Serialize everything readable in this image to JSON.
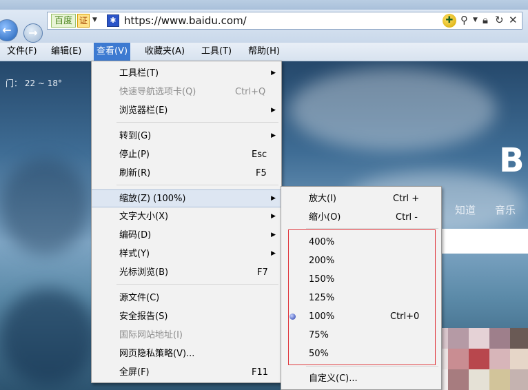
{
  "address_bar": {
    "search_engine_label": "百度",
    "cert_label": "证",
    "url": "https://www.baidu.com/"
  },
  "menubar": [
    {
      "label": "文件(F)"
    },
    {
      "label": "编辑(E)"
    },
    {
      "label": "查看(V)"
    },
    {
      "label": "收藏夹(A)"
    },
    {
      "label": "工具(T)"
    },
    {
      "label": "帮助(H)"
    }
  ],
  "page": {
    "weather": "门：  22 ~ 18°",
    "logo_partial": "B",
    "links": [
      "知道",
      "音乐"
    ]
  },
  "view_menu": {
    "items": [
      {
        "label": "工具栏(T)",
        "shortcut": ""
      },
      {
        "label": "快速导航选项卡(Q)",
        "shortcut": "Ctrl+Q"
      },
      {
        "label": "浏览器栏(E)",
        "shortcut": ""
      },
      {
        "label": "转到(G)",
        "shortcut": ""
      },
      {
        "label": "停止(P)",
        "shortcut": "Esc"
      },
      {
        "label": "刷新(R)",
        "shortcut": "F5"
      },
      {
        "label": "缩放(Z) (100%)",
        "shortcut": ""
      },
      {
        "label": "文字大小(X)",
        "shortcut": ""
      },
      {
        "label": "编码(D)",
        "shortcut": ""
      },
      {
        "label": "样式(Y)",
        "shortcut": ""
      },
      {
        "label": "光标浏览(B)",
        "shortcut": "F7"
      },
      {
        "label": "源文件(C)",
        "shortcut": ""
      },
      {
        "label": "安全报告(S)",
        "shortcut": ""
      },
      {
        "label": "国际网站地址(I)",
        "shortcut": ""
      },
      {
        "label": "网页隐私策略(V)...",
        "shortcut": ""
      },
      {
        "label": "全屏(F)",
        "shortcut": "F11"
      }
    ]
  },
  "zoom_menu": {
    "items": [
      {
        "label": "放大(I)",
        "shortcut": "Ctrl +"
      },
      {
        "label": "缩小(O)",
        "shortcut": "Ctrl -"
      },
      {
        "label": "400%",
        "shortcut": ""
      },
      {
        "label": "200%",
        "shortcut": ""
      },
      {
        "label": "150%",
        "shortcut": ""
      },
      {
        "label": "125%",
        "shortcut": ""
      },
      {
        "label": "100%",
        "shortcut": "Ctrl+0"
      },
      {
        "label": "75%",
        "shortcut": ""
      },
      {
        "label": "50%",
        "shortcut": ""
      },
      {
        "label": "自定义(C)...",
        "shortcut": ""
      }
    ],
    "selected": "100%"
  }
}
